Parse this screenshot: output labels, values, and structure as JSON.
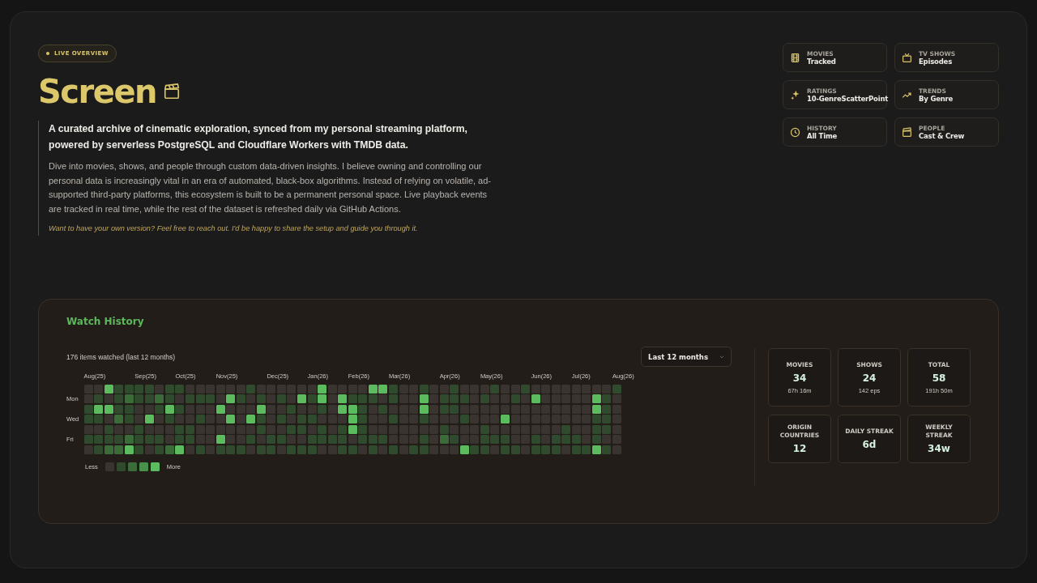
{
  "badge": "LIVE OVERVIEW",
  "title": "Screen",
  "lead": "A curated archive of cinematic exploration, synced from my personal streaming platform, powered by serverless PostgreSQL and Cloudflare Workers with TMDB data.",
  "body": "Dive into movies, shows, and people through custom data-driven insights. I believe owning and controlling our personal data is increasingly vital in an era of automated, black-box algorithms. Instead of relying on volatile, ad-supported third-party platforms, this ecosystem is built to be a permanent personal space. Live playback events are tracked in real time, while the rest of the dataset is refreshed daily via GitHub Actions.",
  "invite": "Want to have your own version? Feel free to reach out. I'd be happy to share the setup and guide you through it.",
  "nav_cards": [
    {
      "label": "MOVIES",
      "value": "Tracked"
    },
    {
      "label": "TV SHOWS",
      "value": "Episodes"
    },
    {
      "label": "RATINGS",
      "value": "10-GenreScatterPoint"
    },
    {
      "label": "TRENDS",
      "value": "By Genre"
    },
    {
      "label": "HISTORY",
      "value": "All Time"
    },
    {
      "label": "PEOPLE",
      "value": "Cast & Crew"
    }
  ],
  "watch_history": {
    "title": "Watch History",
    "summary": "176 items watched (last 12 months)",
    "range_select": {
      "value": "Last 12 months"
    },
    "day_labels": [
      "Mon",
      "Wed",
      "Fri"
    ],
    "weeks": [
      {
        "month": "Aug(25)",
        "days": [
          {
            "color": "#3a3431"
          },
          {
            "color": "#3a3431"
          },
          {
            "color": "#2f4a2d"
          },
          {
            "color": "#2f4a2d"
          },
          {
            "color": "#3a3431"
          },
          {
            "color": "#2f4a2d"
          },
          {
            "color": "#3a3431"
          }
        ]
      },
      {
        "days": [
          {
            "color": "#3a3431"
          },
          {
            "color": "#2f4a2d"
          },
          {
            "color": "#5dbb5f"
          },
          {
            "color": "#2f4a2d"
          },
          {
            "color": "#3a3431"
          },
          {
            "color": "#2f4a2d"
          },
          {
            "color": "#2f4a2d"
          }
        ]
      },
      {
        "days": [
          {
            "color": "#5dbb5f"
          },
          {
            "color": "#3a3431"
          },
          {
            "color": "#5dbb5f"
          },
          {
            "color": "#3a3431"
          },
          {
            "color": "#2f4a2d"
          },
          {
            "color": "#2f4a2d"
          },
          {
            "color": "#3a6b38"
          }
        ]
      },
      {
        "days": [
          {
            "color": "#2f4a2d"
          },
          {
            "color": "#2f4a2d"
          },
          {
            "color": "#2f4a2d"
          },
          {
            "color": "#3a6b38"
          },
          {
            "color": "#3a3431"
          },
          {
            "color": "#2f4a2d"
          },
          {
            "color": "#3a6b38"
          }
        ]
      },
      {
        "days": [
          {
            "color": "#2f4a2d"
          },
          {
            "color": "#3a6b38"
          },
          {
            "color": "#2f4a2d"
          },
          {
            "color": "#2f4a2d"
          },
          {
            "color": "#3a3431"
          },
          {
            "color": "#3a6b38"
          },
          {
            "color": "#5dbb5f"
          }
        ]
      },
      {
        "month": "Sep(25)",
        "days": [
          {
            "color": "#2f4a2d"
          },
          {
            "color": "#2f4a2d"
          },
          {
            "color": "#3a3431"
          },
          {
            "color": "#3a3431"
          },
          {
            "color": "#2f4a2d"
          },
          {
            "color": "#2f4a2d"
          },
          {
            "color": "#2f4a2d"
          }
        ]
      },
      {
        "days": [
          {
            "color": "#2f4a2d"
          },
          {
            "color": "#2f4a2d"
          },
          {
            "color": "#3a3431"
          },
          {
            "color": "#5dbb5f"
          },
          {
            "color": "#3a3431"
          },
          {
            "color": "#2f4a2d"
          },
          {
            "color": "#3a3431"
          }
        ]
      },
      {
        "days": [
          {
            "color": "#3a3431"
          },
          {
            "color": "#3a6b38"
          },
          {
            "color": "#2f4a2d"
          },
          {
            "color": "#3a3431"
          },
          {
            "color": "#3a3431"
          },
          {
            "color": "#2f4a2d"
          },
          {
            "color": "#2f4a2d"
          }
        ]
      },
      {
        "days": [
          {
            "color": "#2f4a2d"
          },
          {
            "color": "#2f4a2d"
          },
          {
            "color": "#5dbb5f"
          },
          {
            "color": "#2f4a2d"
          },
          {
            "color": "#3a3431"
          },
          {
            "color": "#3a3431"
          },
          {
            "color": "#3a6b38"
          }
        ]
      },
      {
        "month": "Oct(25)",
        "days": [
          {
            "color": "#2f4a2d"
          },
          {
            "color": "#3a3431"
          },
          {
            "color": "#2f4a2d"
          },
          {
            "color": "#3a3431"
          },
          {
            "color": "#2f4a2d"
          },
          {
            "color": "#2f4a2d"
          },
          {
            "color": "#5dbb5f"
          }
        ]
      },
      {
        "days": [
          {
            "color": "#3a3431"
          },
          {
            "color": "#2f4a2d"
          },
          {
            "color": "#3a3431"
          },
          {
            "color": "#3a3431"
          },
          {
            "color": "#2f4a2d"
          },
          {
            "color": "#2f4a2d"
          },
          {
            "color": "#3a3431"
          }
        ]
      },
      {
        "days": [
          {
            "color": "#3a3431"
          },
          {
            "color": "#2f4a2d"
          },
          {
            "color": "#3a3431"
          },
          {
            "color": "#2f4a2d"
          },
          {
            "color": "#3a3431"
          },
          {
            "color": "#3a3431"
          },
          {
            "color": "#2f4a2d"
          }
        ]
      },
      {
        "days": [
          {
            "color": "#3a3431"
          },
          {
            "color": "#2f4a2d"
          },
          {
            "color": "#3a3431"
          },
          {
            "color": "#3a3431"
          },
          {
            "color": "#3a3431"
          },
          {
            "color": "#3a3431"
          },
          {
            "color": "#3a3431"
          }
        ]
      },
      {
        "month": "Nov(25)",
        "days": [
          {
            "color": "#3a3431"
          },
          {
            "color": "#3a3431"
          },
          {
            "color": "#5dbb5f"
          },
          {
            "color": "#3a3431"
          },
          {
            "color": "#3a3431"
          },
          {
            "color": "#5dbb5f"
          },
          {
            "color": "#2f4a2d"
          }
        ]
      },
      {
        "days": [
          {
            "color": "#3a3431"
          },
          {
            "color": "#5dbb5f"
          },
          {
            "color": "#3a3431"
          },
          {
            "color": "#5dbb5f"
          },
          {
            "color": "#3a3431"
          },
          {
            "color": "#3a3431"
          },
          {
            "color": "#2f4a2d"
          }
        ]
      },
      {
        "days": [
          {
            "color": "#3a3431"
          },
          {
            "color": "#2f4a2d"
          },
          {
            "color": "#3a3431"
          },
          {
            "color": "#3a3431"
          },
          {
            "color": "#3a3431"
          },
          {
            "color": "#3a3431"
          },
          {
            "color": "#2f4a2d"
          }
        ]
      },
      {
        "days": [
          {
            "color": "#2f4a2d"
          },
          {
            "color": "#3a3431"
          },
          {
            "color": "#3a3431"
          },
          {
            "color": "#5dbb5f"
          },
          {
            "color": "#3a3431"
          },
          {
            "color": "#2f4a2d"
          },
          {
            "color": "#3a3431"
          }
        ]
      },
      {
        "days": [
          {
            "color": "#3a3431"
          },
          {
            "color": "#2f4a2d"
          },
          {
            "color": "#5dbb5f"
          },
          {
            "color": "#2f4a2d"
          },
          {
            "color": "#2f4a2d"
          },
          {
            "color": "#3a3431"
          },
          {
            "color": "#2f4a2d"
          }
        ]
      },
      {
        "month": "Dec(25)",
        "days": [
          {
            "color": "#3a3431"
          },
          {
            "color": "#3a3431"
          },
          {
            "color": "#3a3431"
          },
          {
            "color": "#3a3431"
          },
          {
            "color": "#3a3431"
          },
          {
            "color": "#2f4a2d"
          },
          {
            "color": "#2f4a2d"
          }
        ]
      },
      {
        "days": [
          {
            "color": "#3a3431"
          },
          {
            "color": "#2f4a2d"
          },
          {
            "color": "#3a3431"
          },
          {
            "color": "#2f4a2d"
          },
          {
            "color": "#3a3431"
          },
          {
            "color": "#2f4a2d"
          },
          {
            "color": "#3a3431"
          }
        ]
      },
      {
        "days": [
          {
            "color": "#3a3431"
          },
          {
            "color": "#3a3431"
          },
          {
            "color": "#2f4a2d"
          },
          {
            "color": "#3a3431"
          },
          {
            "color": "#2f4a2d"
          },
          {
            "color": "#3a3431"
          },
          {
            "color": "#2f4a2d"
          }
        ]
      },
      {
        "days": [
          {
            "color": "#3a3431"
          },
          {
            "color": "#5dbb5f"
          },
          {
            "color": "#3a3431"
          },
          {
            "color": "#2f4a2d"
          },
          {
            "color": "#2f4a2d"
          },
          {
            "color": "#3a3431"
          },
          {
            "color": "#2f4a2d"
          }
        ]
      },
      {
        "month": "Jan(26)",
        "days": [
          {
            "color": "#3a3431"
          },
          {
            "color": "#2f4a2d"
          },
          {
            "color": "#3a3431"
          },
          {
            "color": "#2f4a2d"
          },
          {
            "color": "#3a3431"
          },
          {
            "color": "#2f4a2d"
          },
          {
            "color": "#2f4a2d"
          }
        ]
      },
      {
        "days": [
          {
            "color": "#5dbb5f"
          },
          {
            "color": "#5dbb5f"
          },
          {
            "color": "#2f4a2d"
          },
          {
            "color": "#3a3431"
          },
          {
            "color": "#2f4a2d"
          },
          {
            "color": "#2f4a2d"
          },
          {
            "color": "#3a3431"
          }
        ]
      },
      {
        "days": [
          {
            "color": "#3a3431"
          },
          {
            "color": "#3a3431"
          },
          {
            "color": "#3a3431"
          },
          {
            "color": "#3a3431"
          },
          {
            "color": "#3a3431"
          },
          {
            "color": "#2f4a2d"
          },
          {
            "color": "#3a3431"
          }
        ]
      },
      {
        "days": [
          {
            "color": "#3a3431"
          },
          {
            "color": "#5dbb5f"
          },
          {
            "color": "#5dbb5f"
          },
          {
            "color": "#3a3431"
          },
          {
            "color": "#2f4a2d"
          },
          {
            "color": "#2f4a2d"
          },
          {
            "color": "#2f4a2d"
          }
        ]
      },
      {
        "month": "Feb(26)",
        "days": [
          {
            "color": "#3a3431"
          },
          {
            "color": "#2f4a2d"
          },
          {
            "color": "#5dbb5f"
          },
          {
            "color": "#5dbb5f"
          },
          {
            "color": "#5dbb5f"
          },
          {
            "color": "#3a3431"
          },
          {
            "color": "#2f4a2d"
          }
        ]
      },
      {
        "days": [
          {
            "color": "#3a3431"
          },
          {
            "color": "#2f4a2d"
          },
          {
            "color": "#2f4a2d"
          },
          {
            "color": "#2f4a2d"
          },
          {
            "color": "#2f4a2d"
          },
          {
            "color": "#2f4a2d"
          },
          {
            "color": "#3a3431"
          }
        ]
      },
      {
        "days": [
          {
            "color": "#5dbb5f"
          },
          {
            "color": "#2f4a2d"
          },
          {
            "color": "#3a3431"
          },
          {
            "color": "#3a3431"
          },
          {
            "color": "#3a3431"
          },
          {
            "color": "#2f4a2d"
          },
          {
            "color": "#2f4a2d"
          }
        ]
      },
      {
        "days": [
          {
            "color": "#5dbb5f"
          },
          {
            "color": "#3a3431"
          },
          {
            "color": "#2f4a2d"
          },
          {
            "color": "#3a3431"
          },
          {
            "color": "#3a3431"
          },
          {
            "color": "#2f4a2d"
          },
          {
            "color": "#3a3431"
          }
        ]
      },
      {
        "month": "Mar(26)",
        "days": [
          {
            "color": "#2f4a2d"
          },
          {
            "color": "#2f4a2d"
          },
          {
            "color": "#3a3431"
          },
          {
            "color": "#2f4a2d"
          },
          {
            "color": "#3a3431"
          },
          {
            "color": "#3a3431"
          },
          {
            "color": "#2f4a2d"
          }
        ]
      },
      {
        "days": [
          {
            "color": "#3a3431"
          },
          {
            "color": "#3a3431"
          },
          {
            "color": "#3a3431"
          },
          {
            "color": "#3a3431"
          },
          {
            "color": "#3a3431"
          },
          {
            "color": "#3a3431"
          },
          {
            "color": "#3a3431"
          }
        ]
      },
      {
        "days": [
          {
            "color": "#3a3431"
          },
          {
            "color": "#3a3431"
          },
          {
            "color": "#3a3431"
          },
          {
            "color": "#3a3431"
          },
          {
            "color": "#3a3431"
          },
          {
            "color": "#3a3431"
          },
          {
            "color": "#2f4a2d"
          }
        ]
      },
      {
        "days": [
          {
            "color": "#2f4a2d"
          },
          {
            "color": "#5dbb5f"
          },
          {
            "color": "#5dbb5f"
          },
          {
            "color": "#2f4a2d"
          },
          {
            "color": "#3a3431"
          },
          {
            "color": "#2f4a2d"
          },
          {
            "color": "#2f4a2d"
          }
        ]
      },
      {
        "days": [
          {
            "color": "#3a3431"
          },
          {
            "color": "#3a3431"
          },
          {
            "color": "#3a3431"
          },
          {
            "color": "#3a3431"
          },
          {
            "color": "#3a3431"
          },
          {
            "color": "#3a3431"
          },
          {
            "color": "#3a3431"
          }
        ]
      },
      {
        "month": "Apr(26)",
        "days": [
          {
            "color": "#3a3431"
          },
          {
            "color": "#2f4a2d"
          },
          {
            "color": "#2f4a2d"
          },
          {
            "color": "#3a3431"
          },
          {
            "color": "#2f4a2d"
          },
          {
            "color": "#3a6b38"
          },
          {
            "color": "#3a3431"
          }
        ]
      },
      {
        "days": [
          {
            "color": "#2f4a2d"
          },
          {
            "color": "#2f4a2d"
          },
          {
            "color": "#2f4a2d"
          },
          {
            "color": "#3a3431"
          },
          {
            "color": "#3a3431"
          },
          {
            "color": "#2f4a2d"
          },
          {
            "color": "#3a3431"
          }
        ]
      },
      {
        "days": [
          {
            "color": "#3a3431"
          },
          {
            "color": "#2f4a2d"
          },
          {
            "color": "#3a3431"
          },
          {
            "color": "#2f4a2d"
          },
          {
            "color": "#3a3431"
          },
          {
            "color": "#3a3431"
          },
          {
            "color": "#5dbb5f"
          }
        ]
      },
      {
        "days": [
          {
            "color": "#3a3431"
          },
          {
            "color": "#3a3431"
          },
          {
            "color": "#3a3431"
          },
          {
            "color": "#3a3431"
          },
          {
            "color": "#3a3431"
          },
          {
            "color": "#3a3431"
          },
          {
            "color": "#2f4a2d"
          }
        ]
      },
      {
        "month": "May(26)",
        "days": [
          {
            "color": "#3a3431"
          },
          {
            "color": "#2f4a2d"
          },
          {
            "color": "#3a3431"
          },
          {
            "color": "#3a3431"
          },
          {
            "color": "#2f4a2d"
          },
          {
            "color": "#2f4a2d"
          },
          {
            "color": "#2f4a2d"
          }
        ]
      },
      {
        "days": [
          {
            "color": "#2f4a2d"
          },
          {
            "color": "#3a3431"
          },
          {
            "color": "#3a3431"
          },
          {
            "color": "#3a3431"
          },
          {
            "color": "#3a3431"
          },
          {
            "color": "#2f4a2d"
          },
          {
            "color": "#3a3431"
          }
        ]
      },
      {
        "days": [
          {
            "color": "#3a3431"
          },
          {
            "color": "#3a3431"
          },
          {
            "color": "#3a3431"
          },
          {
            "color": "#5dbb5f"
          },
          {
            "color": "#3a3431"
          },
          {
            "color": "#2f4a2d"
          },
          {
            "color": "#2f4a2d"
          }
        ]
      },
      {
        "days": [
          {
            "color": "#3a3431"
          },
          {
            "color": "#2f4a2d"
          },
          {
            "color": "#3a3431"
          },
          {
            "color": "#3a3431"
          },
          {
            "color": "#3a3431"
          },
          {
            "color": "#3a3431"
          },
          {
            "color": "#2f4a2d"
          }
        ]
      },
      {
        "days": [
          {
            "color": "#2f4a2d"
          },
          {
            "color": "#3a3431"
          },
          {
            "color": "#3a3431"
          },
          {
            "color": "#3a3431"
          },
          {
            "color": "#3a3431"
          },
          {
            "color": "#3a3431"
          },
          {
            "color": "#3a3431"
          }
        ]
      },
      {
        "month": "Jun(26)",
        "days": [
          {
            "color": "#3a3431"
          },
          {
            "color": "#5dbb5f"
          },
          {
            "color": "#3a3431"
          },
          {
            "color": "#3a3431"
          },
          {
            "color": "#3a3431"
          },
          {
            "color": "#2f4a2d"
          },
          {
            "color": "#2f4a2d"
          }
        ]
      },
      {
        "days": [
          {
            "color": "#3a3431"
          },
          {
            "color": "#3a3431"
          },
          {
            "color": "#3a3431"
          },
          {
            "color": "#3a3431"
          },
          {
            "color": "#3a3431"
          },
          {
            "color": "#3a3431"
          },
          {
            "color": "#2f4a2d"
          }
        ]
      },
      {
        "days": [
          {
            "color": "#3a3431"
          },
          {
            "color": "#3a3431"
          },
          {
            "color": "#3a3431"
          },
          {
            "color": "#3a3431"
          },
          {
            "color": "#3a3431"
          },
          {
            "color": "#2f4a2d"
          },
          {
            "color": "#2f4a2d"
          }
        ]
      },
      {
        "days": [
          {
            "color": "#3a3431"
          },
          {
            "color": "#3a3431"
          },
          {
            "color": "#3a3431"
          },
          {
            "color": "#3a3431"
          },
          {
            "color": "#2f4a2d"
          },
          {
            "color": "#2f4a2d"
          },
          {
            "color": "#3a3431"
          }
        ]
      },
      {
        "month": "Jul(26)",
        "days": [
          {
            "color": "#3a3431"
          },
          {
            "color": "#3a3431"
          },
          {
            "color": "#3a3431"
          },
          {
            "color": "#3a3431"
          },
          {
            "color": "#3a3431"
          },
          {
            "color": "#2f4a2d"
          },
          {
            "color": "#2f4a2d"
          }
        ]
      },
      {
        "days": [
          {
            "color": "#3a3431"
          },
          {
            "color": "#3a3431"
          },
          {
            "color": "#3a3431"
          },
          {
            "color": "#3a3431"
          },
          {
            "color": "#3a3431"
          },
          {
            "color": "#3a3431"
          },
          {
            "color": "#2f4a2d"
          }
        ]
      },
      {
        "days": [
          {
            "color": "#3a3431"
          },
          {
            "color": "#5dbb5f"
          },
          {
            "color": "#5dbb5f"
          },
          {
            "color": "#2f4a2d"
          },
          {
            "color": "#2f4a2d"
          },
          {
            "color": "#2f4a2d"
          },
          {
            "color": "#5dbb5f"
          }
        ]
      },
      {
        "days": [
          {
            "color": "#3a3431"
          },
          {
            "color": "#2f4a2d"
          },
          {
            "color": "#2f4a2d"
          },
          {
            "color": "#2f4a2d"
          },
          {
            "color": "#2f4a2d"
          },
          {
            "color": "#3a3431"
          },
          {
            "color": "#2f4a2d"
          }
        ]
      },
      {
        "month": "Aug(26)",
        "days": [
          {
            "color": "#2f4a2d"
          },
          {
            "color": "#3a3431"
          },
          {
            "color": "#3a3431"
          },
          {
            "color": "#3a3431"
          },
          {
            "color": "#3a3431"
          },
          {
            "color": "#3a3431"
          },
          {
            "color": "#3a3431"
          }
        ]
      }
    ],
    "legend": {
      "less": "Less",
      "more": "More",
      "swatches": [
        {
          "color": "#3a3431"
        },
        {
          "color": "#2f4a2d"
        },
        {
          "color": "#3a6b38"
        },
        {
          "color": "#47914a"
        },
        {
          "color": "#5dbb5f"
        }
      ]
    },
    "stats": [
      {
        "label": "MOVIES",
        "value": "34",
        "detail": "67h 16m"
      },
      {
        "label": "SHOWS",
        "value": "24",
        "detail": "142 eps"
      },
      {
        "label": "TOTAL",
        "value": "58",
        "detail": "191h 50m"
      },
      {
        "label": "ORIGIN COUNTRIES",
        "value": "12"
      },
      {
        "label": "DAILY STREAK",
        "value": "6d"
      },
      {
        "label": "WEEKLY STREAK",
        "value": "34w"
      }
    ]
  }
}
